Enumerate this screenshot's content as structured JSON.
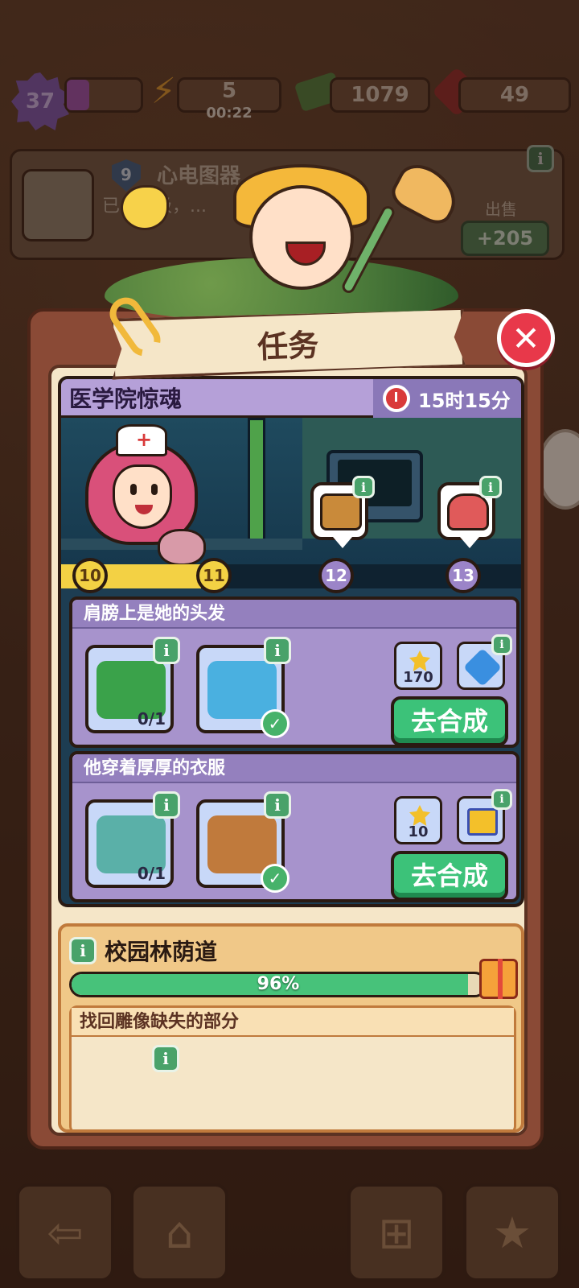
{
  "top": {
    "level": "37",
    "energy": "5",
    "energy_timer": "00:22",
    "cash": "1079",
    "gems": "49"
  },
  "info_card": {
    "badge_level": "9",
    "item_name": "心电图器",
    "description": "已...高级，...",
    "sell_label": "出售",
    "sell_value": "+205"
  },
  "modal": {
    "title": "任务"
  },
  "chapter": {
    "title": "医学院惊魂",
    "timer": "15时15分",
    "progress": 0.3,
    "nodes": [
      "10",
      "11",
      "12",
      "13"
    ]
  },
  "tasks": [
    {
      "title": "肩膀上是她的头发",
      "requirements": [
        {
          "item": "green-hat",
          "count": "0/1",
          "complete": false
        },
        {
          "item": "ecg-monitor",
          "count": "",
          "complete": true
        }
      ],
      "rewards": [
        {
          "icon": "gold-star-icon",
          "amount": "170"
        },
        {
          "icon": "blue-gem-icon",
          "amount": ""
        }
      ],
      "action_label": "去合成"
    },
    {
      "title": "他穿着厚厚的衣服",
      "requirements": [
        {
          "item": "blood-pressure-monitor",
          "count": "0/1",
          "complete": false
        },
        {
          "item": "binoculars",
          "count": "",
          "complete": true
        }
      ],
      "rewards": [
        {
          "icon": "gold-star-icon",
          "amount": "10"
        },
        {
          "icon": "gift-box-icon",
          "amount": ""
        }
      ],
      "action_label": "去合成"
    }
  ],
  "garden": {
    "title": "校园林荫道",
    "progress": 0.96,
    "progress_text": "96%",
    "task_title": "找回雕像缺失的部分"
  },
  "colors": {
    "close": "#e8384a",
    "go_button": "#3cc279",
    "task_card": "#a793cc",
    "progress_green": "#47c27a"
  },
  "info_glyph": "i",
  "check_glyph": "✓",
  "close_glyph": "✕"
}
